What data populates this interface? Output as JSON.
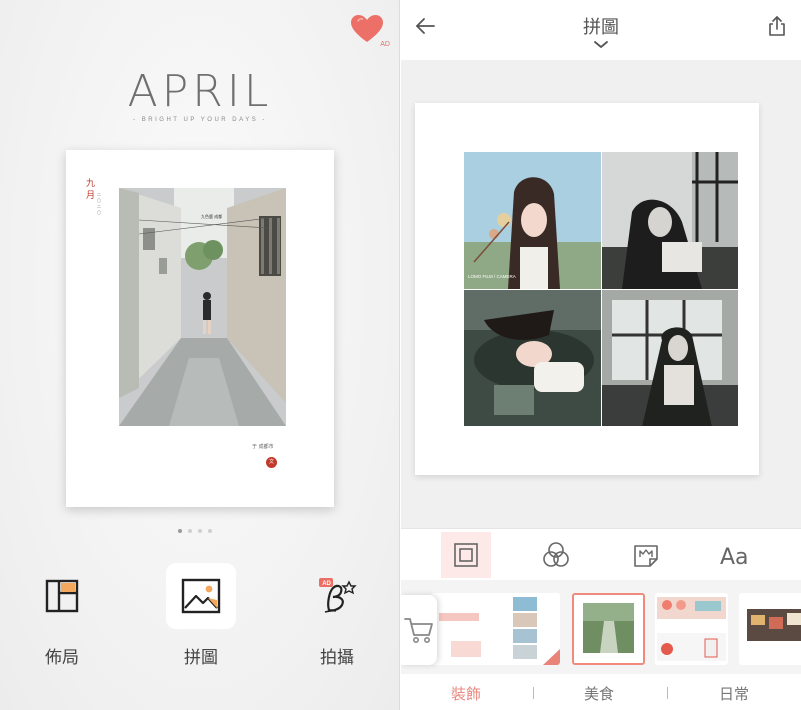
{
  "left": {
    "ad_badge": "AD",
    "brand": {
      "title": "APRIL",
      "tagline": "- BRIGHT UP YOUR DAYS -"
    },
    "poster": {
      "month": "九月",
      "year": "二〇二〇",
      "sign": "九色鹿 成都",
      "location": "于 成都市",
      "stamp": "文"
    },
    "pager": {
      "count": 4,
      "active": 1
    },
    "buttons": [
      {
        "label": "佈局",
        "icon": "layout-grid-icon"
      },
      {
        "label": "拼圖",
        "icon": "image-icon"
      },
      {
        "label": "拍攝",
        "icon": "b-camera-app-icon",
        "badge": "AD"
      }
    ]
  },
  "right": {
    "header": {
      "title": "拼圖"
    },
    "watermark": "LOMO FILM / CAMERA",
    "tools": [
      "frame-icon",
      "filter-circles-icon",
      "sticker-crown-icon",
      "text-aa-icon"
    ],
    "text_tool_label": "Aa",
    "categories": [
      {
        "label": "裝飾",
        "active": true
      },
      {
        "label": "美食",
        "active": false
      },
      {
        "label": "日常",
        "active": false
      }
    ],
    "colors": {
      "accent": "#e98a80",
      "selected_border": "#f08a7e",
      "active_tool_bg": "#fde9e8"
    }
  }
}
